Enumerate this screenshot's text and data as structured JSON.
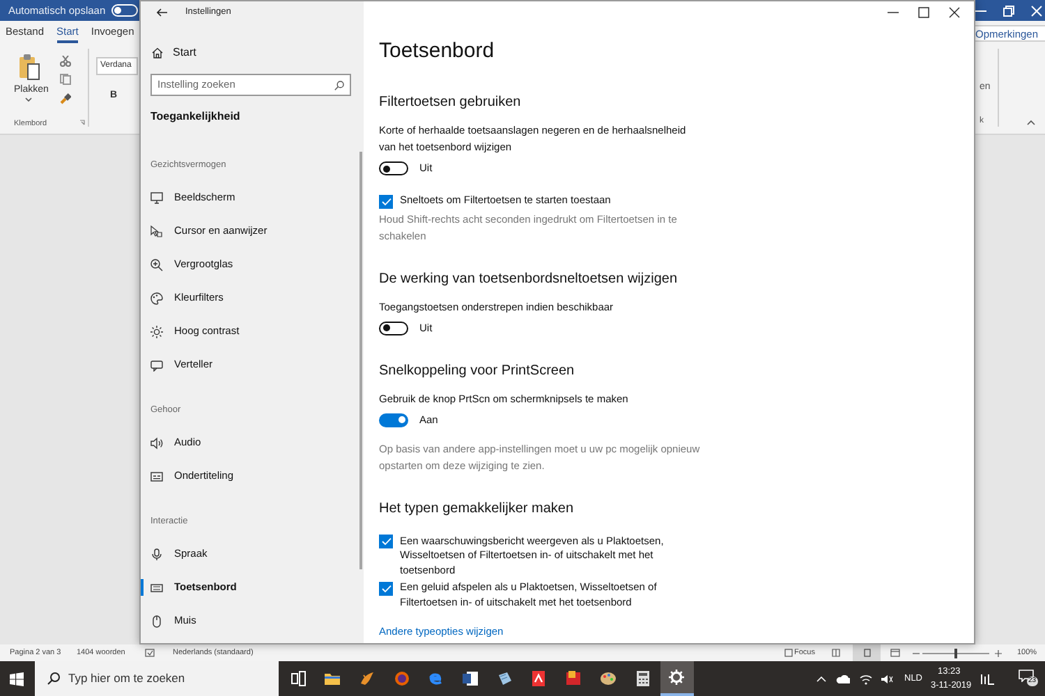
{
  "word": {
    "autosave": {
      "label": "Automatisch opslaan",
      "on": false
    },
    "tabs": [
      {
        "label": "Bestand",
        "selected": false
      },
      {
        "label": "Start",
        "selected": true
      },
      {
        "label": "Invoegen",
        "selected": false
      }
    ],
    "comments_button": "Opmerkingen",
    "ribbon": {
      "paste": "Plakken",
      "group": "Klembord",
      "font": "Verdana",
      "bold": "B",
      "fragment_1": "en",
      "fragment_2": "k"
    },
    "status_bar": {
      "page": "Pagina 2 van 3",
      "words": "1404 woorden",
      "language": "Nederlands (standaard)",
      "focus": "Focus",
      "zoom_slider": {
        "level": 0.5
      },
      "zoom": "100%"
    }
  },
  "taskbar": {
    "search_placeholder": "Typ hier om te zoeken",
    "language": "NLD",
    "time": "13:23",
    "date": "3-11-2019",
    "notifications": "23"
  },
  "settings": {
    "title": "Instellingen",
    "home": "Start",
    "search_placeholder": "Instelling zoeken",
    "heading": "Toegankelijkheid",
    "groups": [
      {
        "label": "Gezichtsvermogen",
        "items": [
          {
            "label": "Beeldscherm",
            "selected": false
          },
          {
            "label": "Cursor en aanwijzer",
            "selected": false
          },
          {
            "label": "Vergrootglas",
            "selected": false
          },
          {
            "label": "Kleurfilters",
            "selected": false
          },
          {
            "label": "Hoog contrast",
            "selected": false
          },
          {
            "label": "Verteller",
            "selected": false
          }
        ]
      },
      {
        "label": "Gehoor",
        "items": [
          {
            "label": "Audio",
            "selected": false
          },
          {
            "label": "Ondertiteling",
            "selected": false
          }
        ]
      },
      {
        "label": "Interactie",
        "items": [
          {
            "label": "Spraak",
            "selected": false
          },
          {
            "label": "Toetsenbord",
            "selected": true
          },
          {
            "label": "Muis",
            "selected": false
          }
        ]
      }
    ],
    "page_title": "Toetsenbord",
    "sections": [
      {
        "heading": "Filtertoetsen gebruiken",
        "controls": [
          {
            "kind": "toggle",
            "label": "Korte of herhaalde toetsaanslagen negeren en de herhaalsnelheid van het toetsenbord wijzigen",
            "on": false,
            "state_label": "Uit"
          },
          {
            "kind": "checkbox",
            "label": "Sneltoets om Filtertoetsen te starten toestaan",
            "checked": true
          },
          {
            "kind": "hint",
            "text": "Houd Shift-rechts acht seconden ingedrukt om Filtertoetsen in te schakelen"
          }
        ]
      },
      {
        "heading": "De werking van toetsenbordsneltoetsen wijzigen",
        "controls": [
          {
            "kind": "toggle",
            "label": "Toegangstoetsen onderstrepen indien beschikbaar",
            "on": false,
            "state_label": "Uit"
          }
        ]
      },
      {
        "heading": "Snelkoppeling voor PrintScreen",
        "controls": [
          {
            "kind": "toggle",
            "label": "Gebruik de knop PrtScn om schermknipsels te maken",
            "on": true,
            "state_label": "Aan"
          },
          {
            "kind": "hint",
            "text": "Op basis van andere app-instellingen moet u uw pc mogelijk opnieuw opstarten om deze wijziging te zien."
          }
        ]
      },
      {
        "heading": "Het typen gemakkelijker maken",
        "controls": [
          {
            "kind": "checkbox",
            "label": "Een waarschuwingsbericht weergeven als u Plaktoetsen, Wisseltoetsen of Filtertoetsen in- of uitschakelt met het toetsenbord",
            "checked": true
          },
          {
            "kind": "checkbox",
            "label": "Een geluid afspelen als u Plaktoetsen, Wisseltoetsen of Filtertoetsen in- of uitschakelt met het toetsenbord",
            "checked": true
          },
          {
            "kind": "link",
            "text": "Andere typeopties wijzigen"
          }
        ]
      }
    ]
  }
}
